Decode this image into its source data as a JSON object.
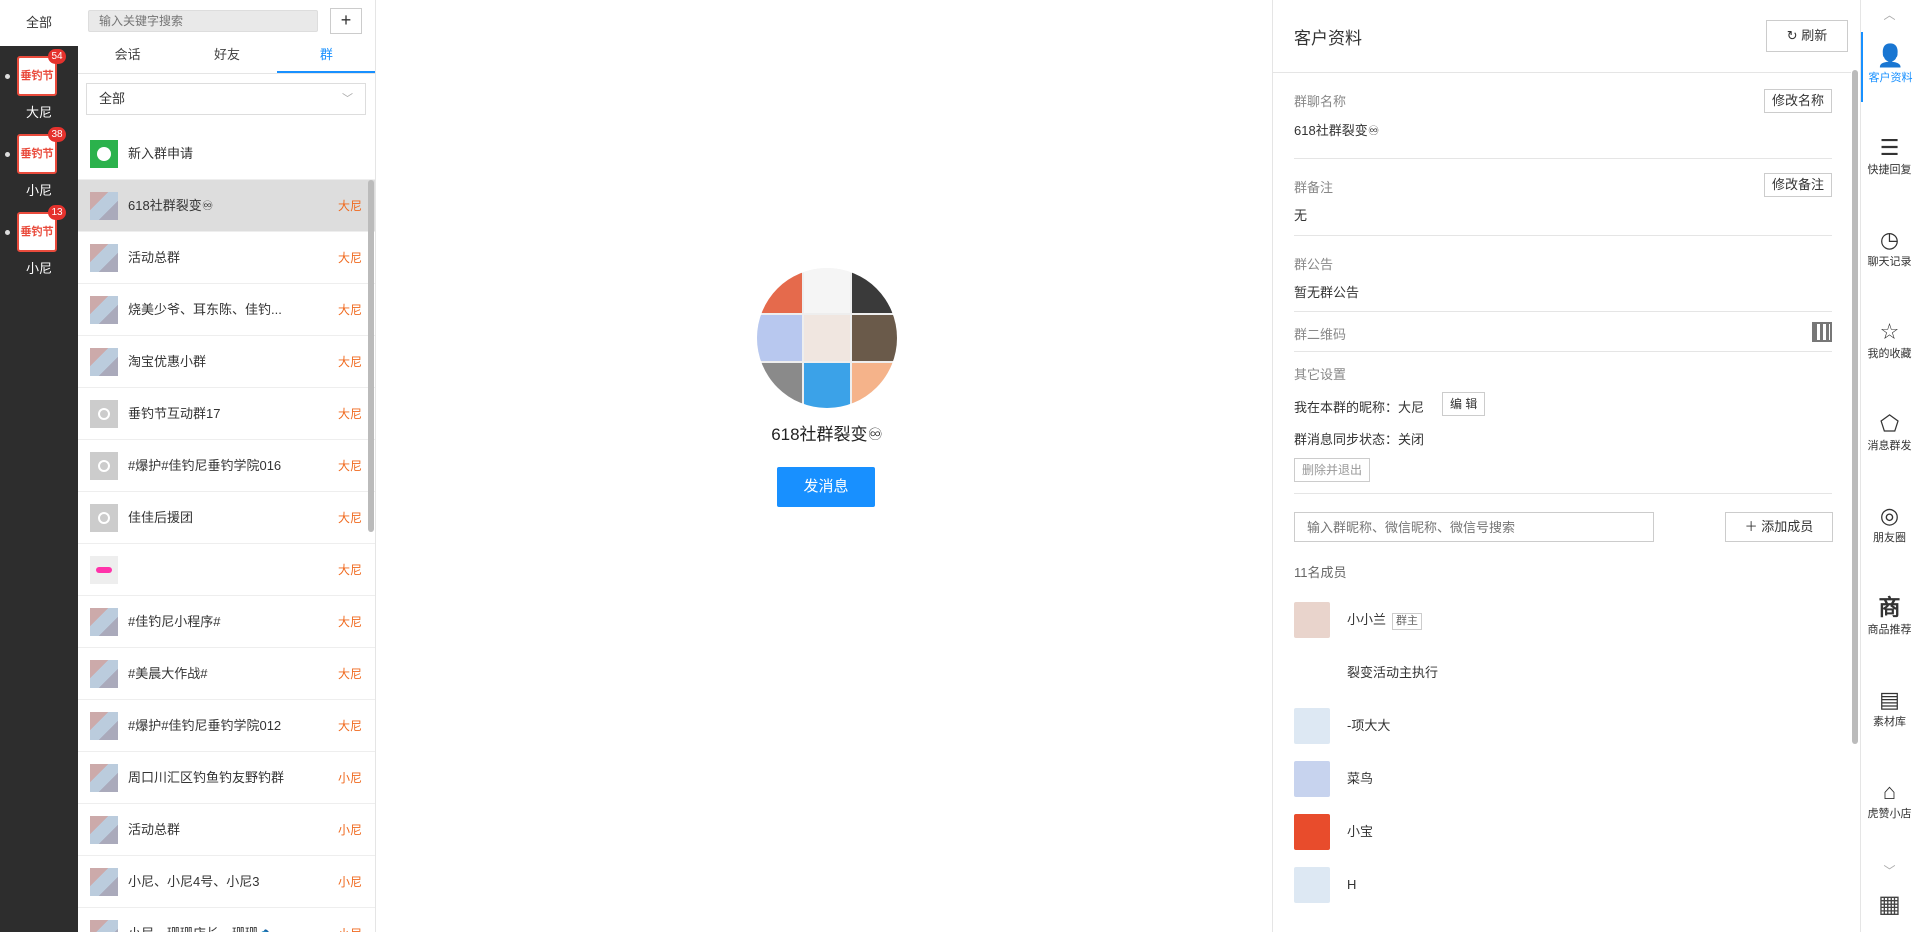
{
  "accounts": {
    "all_label": "全部",
    "items": [
      {
        "name": "大尼",
        "badge": "54",
        "logo": "垂钓节"
      },
      {
        "name": "小尼",
        "badge": "38",
        "logo": "垂钓节"
      },
      {
        "name": "小尼",
        "badge": "13",
        "logo": "垂钓节"
      }
    ]
  },
  "list": {
    "search_placeholder": "输入关键字搜索",
    "add_label": "+",
    "tabs": [
      {
        "label": "会话"
      },
      {
        "label": "好友"
      },
      {
        "label": "群"
      }
    ],
    "filter": "全部",
    "new_request": "新入群申请",
    "groups": [
      {
        "name": "618社群裂变♾",
        "owner": "大尼",
        "icon": "grp"
      },
      {
        "name": "活动总群",
        "owner": "大尼",
        "icon": "grp"
      },
      {
        "name": "烧美少爷、耳东陈、佳钓...",
        "owner": "大尼",
        "icon": "grp"
      },
      {
        "name": "淘宝优惠小群",
        "owner": "大尼",
        "icon": "grp"
      },
      {
        "name": "垂钓节互动群17",
        "owner": "大尼",
        "icon": "person"
      },
      {
        "name": "#爆护#佳钓尼垂钓学院016",
        "owner": "大尼",
        "icon": "person"
      },
      {
        "name": "佳佳后援团",
        "owner": "大尼",
        "icon": "person"
      },
      {
        "name": "",
        "owner": "大尼",
        "icon": "pink"
      },
      {
        "name": "#佳钓尼小程序#",
        "owner": "大尼",
        "icon": "grp"
      },
      {
        "name": "#美晨大作战#",
        "owner": "大尼",
        "icon": "grp"
      },
      {
        "name": "#爆护#佳钓尼垂钓学院012",
        "owner": "大尼",
        "icon": "grp"
      },
      {
        "name": "周口川汇区钓鱼钓友野钓群",
        "owner": "小尼",
        "icon": "grp"
      },
      {
        "name": "活动总群",
        "owner": "小尼",
        "icon": "grp"
      },
      {
        "name": "小尼、小尼4号、小尼3",
        "owner": "小尼",
        "icon": "grp"
      },
      {
        "name": "小尼、珊珊店长、珊珊🐟",
        "owner": "小尼",
        "icon": "grp"
      }
    ]
  },
  "center": {
    "group_name": "618社群裂变♾",
    "send_label": "发消息"
  },
  "profile": {
    "title": "客户资料",
    "refresh_label": "刷新",
    "group_name_label": "群聊名称",
    "group_name_value": "618社群裂变♾",
    "rename_label": "修改名称",
    "remark_label": "群备注",
    "remark_value": "无",
    "edit_remark_label": "修改备注",
    "notice_label": "群公告",
    "notice_value": "暂无群公告",
    "qr_label": "群二维码",
    "other_label": "其它设置",
    "nickname_line": "我在本群的昵称：大尼",
    "edit_label": "编 辑",
    "sync_line": "群消息同步状态：关闭",
    "delete_exit_label": "删除并退出",
    "member_search_placeholder": "输入群昵称、微信昵称、微信号搜索",
    "add_member_label": "添加成员",
    "member_count": "11名成员",
    "owner_tag": "群主",
    "members": [
      {
        "name": "小小兰"
      },
      {
        "name": "裂变活动主执行"
      },
      {
        "name": "-项大大"
      },
      {
        "name": "菜鸟"
      },
      {
        "name": "小宝"
      },
      {
        "name": "H"
      }
    ]
  },
  "tools": [
    {
      "label": "客户资料",
      "icon": "profile-icon"
    },
    {
      "label": "快捷回复",
      "icon": "list-icon"
    },
    {
      "label": "聊天记录",
      "icon": "clock-icon"
    },
    {
      "label": "我的收藏",
      "icon": "star-icon"
    },
    {
      "label": "消息群发",
      "icon": "broadcast-icon"
    },
    {
      "label": "朋友圈",
      "icon": "moments-icon"
    },
    {
      "label": "商品推荐",
      "icon": "shop-icon",
      "glyph": "商"
    },
    {
      "label": "素材库",
      "icon": "library-icon"
    },
    {
      "label": "虎赞小店",
      "icon": "store-icon"
    }
  ]
}
